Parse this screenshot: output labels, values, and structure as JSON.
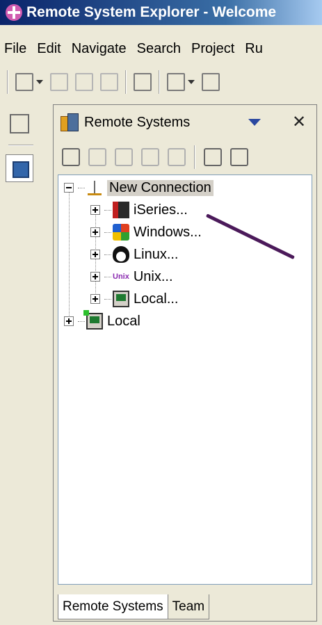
{
  "window": {
    "title": "Remote System Explorer - Welcome"
  },
  "menu": [
    "File",
    "Edit",
    "Navigate",
    "Search",
    "Project",
    "Ru"
  ],
  "view": {
    "title": "Remote Systems",
    "close_label": "✕"
  },
  "tree": {
    "root": "New Connection",
    "children": [
      "iSeries...",
      "Windows...",
      "Linux...",
      "Unix...",
      "Local..."
    ],
    "unix_badge": "Unix",
    "local": "Local"
  },
  "tabs": [
    "Remote Systems",
    "Team"
  ],
  "colors": {
    "annotation": "#4b1a5a",
    "title_bar": "#0a246a"
  }
}
